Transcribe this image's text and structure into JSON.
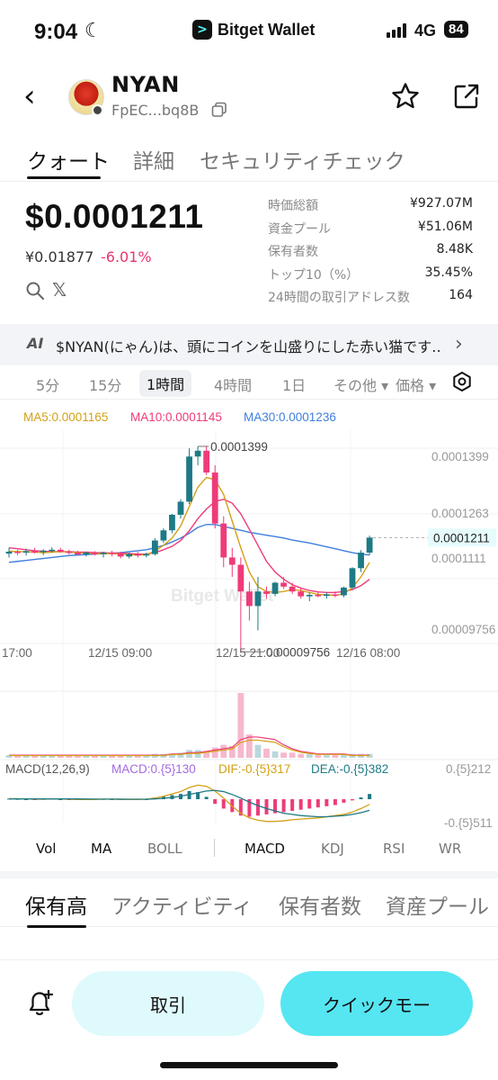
{
  "status_bar": {
    "time": "9:04",
    "app_name": "Bitget Wallet",
    "network": "4G",
    "battery": "84"
  },
  "header": {
    "token_name": "NYAN",
    "token_address": "FpEC...bq8B"
  },
  "tabs": [
    "クォート",
    "詳細",
    "セキュリティチェック"
  ],
  "price": {
    "usd": "$0.0001211",
    "jpy": "¥0.01877",
    "change": "-6.01%"
  },
  "stats": [
    {
      "label": "時価総額",
      "value": "¥927.07M"
    },
    {
      "label": "資金プール",
      "value": "¥51.06M"
    },
    {
      "label": "保有者数",
      "value": "8.48K"
    },
    {
      "label": "トップ10（%）",
      "value": "35.45%"
    },
    {
      "label": "24時間の取引アドレス数",
      "value": "164"
    }
  ],
  "ai_banner": {
    "icon": "AI",
    "text": "$NYAN(にゃん)は、頭にコインを山盛りにした赤い猫です…"
  },
  "intervals": {
    "items": [
      "5分",
      "15分",
      "1時間",
      "4時間",
      "1日"
    ],
    "active": "1時間",
    "more": "その他",
    "price_mode": "価格"
  },
  "ma_legend": {
    "ma5": "MA5:0.0001165",
    "ma10": "MA10:0.0001145",
    "ma30": "MA30:0.0001236"
  },
  "colors": {
    "up": "#1e7a86",
    "down": "#ee3b7a",
    "ma5": "#d4a017",
    "ma10": "#ee3b7a",
    "ma30": "#3f7fdd",
    "accent": "#55e6f2"
  },
  "chart_data": {
    "type": "candlestick",
    "watermark": "Bitget Wallet",
    "x_ticks": [
      "17:00",
      "12/15 09:00",
      "12/15 21:00",
      "12/16 08:00"
    ],
    "y_ticks": [
      "0.0001399",
      "0.0001263",
      "0.0001111",
      "0.00009756"
    ],
    "current_price_label": "0.0001211",
    "high_label": "0.0001399",
    "low_label": "0.00009756",
    "candles": [
      {
        "o": 0.0001178,
        "h": 0.000119,
        "l": 0.000117,
        "c": 0.0001182
      },
      {
        "o": 0.0001182,
        "h": 0.0001186,
        "l": 0.0001175,
        "c": 0.000118
      },
      {
        "o": 0.000118,
        "h": 0.0001188,
        "l": 0.0001174,
        "c": 0.0001183
      },
      {
        "o": 0.0001183,
        "h": 0.000119,
        "l": 0.0001178,
        "c": 0.0001181
      },
      {
        "o": 0.0001181,
        "h": 0.0001187,
        "l": 0.0001175,
        "c": 0.0001184
      },
      {
        "o": 0.0001184,
        "h": 0.0001191,
        "l": 0.000118,
        "c": 0.0001186
      },
      {
        "o": 0.0001186,
        "h": 0.000119,
        "l": 0.000118,
        "c": 0.0001182
      },
      {
        "o": 0.0001182,
        "h": 0.0001186,
        "l": 0.0001176,
        "c": 0.000118
      },
      {
        "o": 0.000118,
        "h": 0.0001184,
        "l": 0.0001174,
        "c": 0.0001176
      },
      {
        "o": 0.0001176,
        "h": 0.0001182,
        "l": 0.0001172,
        "c": 0.000118
      },
      {
        "o": 0.000118,
        "h": 0.0001183,
        "l": 0.0001174,
        "c": 0.0001177
      },
      {
        "o": 0.0001177,
        "h": 0.0001182,
        "l": 0.000117,
        "c": 0.000118
      },
      {
        "o": 0.000118,
        "h": 0.0001184,
        "l": 0.0001172,
        "c": 0.0001178
      },
      {
        "o": 0.0001178,
        "h": 0.0001182,
        "l": 0.0001168,
        "c": 0.0001172
      },
      {
        "o": 0.0001172,
        "h": 0.000118,
        "l": 0.0001168,
        "c": 0.0001177
      },
      {
        "o": 0.0001177,
        "h": 0.0001182,
        "l": 0.000117,
        "c": 0.0001174
      },
      {
        "o": 0.0001174,
        "h": 0.000118,
        "l": 0.000117,
        "c": 0.0001177
      },
      {
        "o": 0.0001177,
        "h": 0.000121,
        "l": 0.0001174,
        "c": 0.0001205
      },
      {
        "o": 0.0001205,
        "h": 0.000123,
        "l": 0.00012,
        "c": 0.0001226
      },
      {
        "o": 0.0001226,
        "h": 0.000126,
        "l": 0.000122,
        "c": 0.0001258
      },
      {
        "o": 0.0001258,
        "h": 0.000129,
        "l": 0.000125,
        "c": 0.0001285
      },
      {
        "o": 0.0001285,
        "h": 0.0001395,
        "l": 0.000128,
        "c": 0.0001378
      },
      {
        "o": 0.0001378,
        "h": 0.0001399,
        "l": 0.000136,
        "c": 0.000139
      },
      {
        "o": 0.000139,
        "h": 0.0001399,
        "l": 0.000134,
        "c": 0.0001345
      },
      {
        "o": 0.0001345,
        "h": 0.000136,
        "l": 0.000123,
        "c": 0.000124
      },
      {
        "o": 0.000124,
        "h": 0.0001255,
        "l": 0.000115,
        "c": 0.000117
      },
      {
        "o": 0.000117,
        "h": 0.000119,
        "l": 0.000113,
        "c": 0.0001155
      },
      {
        "o": 0.0001155,
        "h": 0.000117,
        "l": 9.756e-05,
        "c": 0.00011
      },
      {
        "o": 0.00011,
        "h": 0.000112,
        "l": 0.000104,
        "c": 0.000107
      },
      {
        "o": 0.000107,
        "h": 0.000113,
        "l": 0.000102,
        "c": 0.00011
      },
      {
        "o": 0.00011,
        "h": 0.000111,
        "l": 0.0001085,
        "c": 0.0001095
      },
      {
        "o": 0.0001095,
        "h": 0.000112,
        "l": 0.000109,
        "c": 0.0001118
      },
      {
        "o": 0.0001118,
        "h": 0.000113,
        "l": 0.0001105,
        "c": 0.000111
      },
      {
        "o": 0.000111,
        "h": 0.0001118,
        "l": 0.0001095,
        "c": 0.00011
      },
      {
        "o": 0.00011,
        "h": 0.0001108,
        "l": 0.0001085,
        "c": 0.000109
      },
      {
        "o": 0.000109,
        "h": 0.0001098,
        "l": 0.000108,
        "c": 0.0001093
      },
      {
        "o": 0.0001093,
        "h": 0.0001098,
        "l": 0.0001088,
        "c": 0.0001091
      },
      {
        "o": 0.0001091,
        "h": 0.0001098,
        "l": 0.0001085,
        "c": 0.0001094
      },
      {
        "o": 0.0001094,
        "h": 0.00011,
        "l": 0.0001088,
        "c": 0.0001092
      },
      {
        "o": 0.0001092,
        "h": 0.000111,
        "l": 0.0001088,
        "c": 0.0001108
      },
      {
        "o": 0.0001108,
        "h": 0.000115,
        "l": 0.0001105,
        "c": 0.0001148
      },
      {
        "o": 0.0001148,
        "h": 0.0001185,
        "l": 0.000114,
        "c": 0.000118
      },
      {
        "o": 0.000118,
        "h": 0.0001215,
        "l": 0.0001175,
        "c": 0.0001211
      }
    ],
    "ma5": [
      0.0001183,
      0.0001182,
      0.0001182,
      0.0001181,
      0.000118,
      0.0001181,
      0.0001182,
      0.0001181,
      0.000118,
      0.0001179,
      0.0001178,
      0.0001178,
      0.0001178,
      0.0001177,
      0.0001176,
      0.0001175,
      0.0001176,
      0.0001183,
      0.0001195,
      0.000121,
      0.0001235,
      0.0001275,
      0.0001315,
      0.0001335,
      0.000133,
      0.00013,
      0.0001245,
      0.000119,
      0.000114,
      0.000111,
      0.00011,
      0.0001098,
      0.00011,
      0.0001104,
      0.0001102,
      0.0001098,
      0.0001094,
      0.0001093,
      0.0001092,
      0.0001095,
      0.0001108,
      0.000113,
      0.000116
    ],
    "ma10": [
      0.000119,
      0.0001188,
      0.0001186,
      0.0001184,
      0.0001183,
      0.0001182,
      0.0001182,
      0.0001182,
      0.0001181,
      0.0001181,
      0.000118,
      0.000118,
      0.0001179,
      0.0001179,
      0.0001178,
      0.0001177,
      0.0001177,
      0.000118,
      0.0001186,
      0.0001193,
      0.0001205,
      0.0001225,
      0.000125,
      0.000127,
      0.0001285,
      0.000129,
      0.0001282,
      0.000126,
      0.0001228,
      0.0001195,
      0.0001162,
      0.000114,
      0.0001125,
      0.0001114,
      0.0001107,
      0.0001102,
      0.0001099,
      0.0001098,
      0.0001098,
      0.00011,
      0.0001104,
      0.0001112,
      0.0001125
    ],
    "ma30": [
      0.000116,
      0.0001162,
      0.0001164,
      0.0001166,
      0.0001168,
      0.000117,
      0.0001172,
      0.0001174,
      0.0001175,
      0.0001176,
      0.0001177,
      0.0001178,
      0.0001179,
      0.000118,
      0.0001182,
      0.0001184,
      0.0001186,
      0.000119,
      0.0001195,
      0.0001202,
      0.000121,
      0.000122,
      0.0001232,
      0.0001238,
      0.0001238,
      0.0001234,
      0.000123,
      0.0001226,
      0.0001222,
      0.0001219,
      0.0001216,
      0.0001213,
      0.000121,
      0.0001206,
      0.0001203,
      0.00012,
      0.0001196,
      0.0001192,
      0.0001188,
      0.0001184,
      0.000118,
      0.0001177,
      0.0001175
    ],
    "volume": [
      2,
      2,
      2,
      2,
      2,
      2,
      2,
      2,
      2,
      2,
      2,
      2,
      2,
      2,
      2,
      2,
      2,
      3,
      3,
      3,
      4,
      6,
      6,
      5,
      8,
      10,
      9,
      50,
      18,
      10,
      7,
      5,
      4,
      4,
      3,
      3,
      2,
      2,
      2,
      3,
      3,
      3,
      3
    ],
    "volume_ma": [
      2,
      2,
      2,
      2,
      2,
      2,
      2,
      2,
      2,
      2,
      2,
      2,
      2,
      2,
      2,
      2,
      2,
      2,
      2,
      3,
      3,
      4,
      4,
      5,
      6,
      7,
      8,
      14,
      16,
      16,
      15,
      14,
      10,
      7,
      5,
      4,
      3,
      3,
      3,
      3,
      2,
      2,
      2
    ],
    "macd_legend": {
      "title": "MACD(12,26,9)",
      "macd": "MACD:0.{5}130",
      "dif": "DIF:-0.{5}317",
      "dea": "DEA:-0.{5}382"
    },
    "macd_y_ticks": [
      "0.{5}212",
      "-0.{5}511"
    ],
    "macd_hist": [
      0.1,
      0.05,
      0.0,
      -0.05,
      0.05,
      0.1,
      0.0,
      -0.05,
      -0.1,
      0.0,
      -0.05,
      0.05,
      0.0,
      -0.1,
      0.0,
      -0.05,
      0.0,
      0.3,
      0.5,
      0.7,
      0.9,
      1.4,
      1.2,
      0.4,
      -0.8,
      -1.6,
      -2.2,
      -2.8,
      -3.0,
      -2.8,
      -2.6,
      -2.4,
      -2.2,
      -2.0,
      -1.8,
      -1.6,
      -1.4,
      -1.2,
      -1.0,
      -0.6,
      -0.2,
      0.3,
      0.9
    ],
    "dif": [
      0.1,
      0.1,
      0.05,
      0.0,
      0.0,
      0.05,
      0.05,
      0.0,
      -0.05,
      -0.05,
      -0.05,
      0.0,
      0.0,
      -0.05,
      -0.05,
      -0.05,
      0.0,
      0.2,
      0.5,
      0.9,
      1.3,
      2.0,
      2.4,
      2.2,
      1.4,
      0.2,
      -1.2,
      -2.4,
      -3.2,
      -3.6,
      -3.8,
      -3.8,
      -3.7,
      -3.5,
      -3.4,
      -3.3,
      -3.2,
      -3.0,
      -2.8,
      -2.6,
      -2.2,
      -1.6,
      -0.9
    ],
    "dea": [
      0.05,
      0.05,
      0.05,
      0.05,
      0.05,
      0.05,
      0.05,
      0.05,
      0.05,
      0.03,
      0.02,
      0.02,
      0.02,
      0.01,
      0.0,
      0.0,
      0.0,
      0.05,
      0.15,
      0.3,
      0.5,
      0.8,
      1.1,
      1.4,
      1.5,
      1.3,
      0.8,
      0.2,
      -0.5,
      -1.1,
      -1.6,
      -2.0,
      -2.4,
      -2.6,
      -2.8,
      -2.9,
      -3.0,
      -3.0,
      -2.9,
      -2.8,
      -2.6,
      -2.3,
      -1.9
    ]
  },
  "indicator_tabs": {
    "items": [
      "Vol",
      "MA",
      "BOLL",
      "MACD",
      "KDJ",
      "RSI",
      "WR"
    ],
    "active": [
      "Vol",
      "MA",
      "MACD"
    ]
  },
  "bottom_tabs": [
    "保有高",
    "アクティビティ",
    "保有者数",
    "資産プール"
  ],
  "actions": {
    "trade": "取引",
    "quick": "クイックモー"
  }
}
